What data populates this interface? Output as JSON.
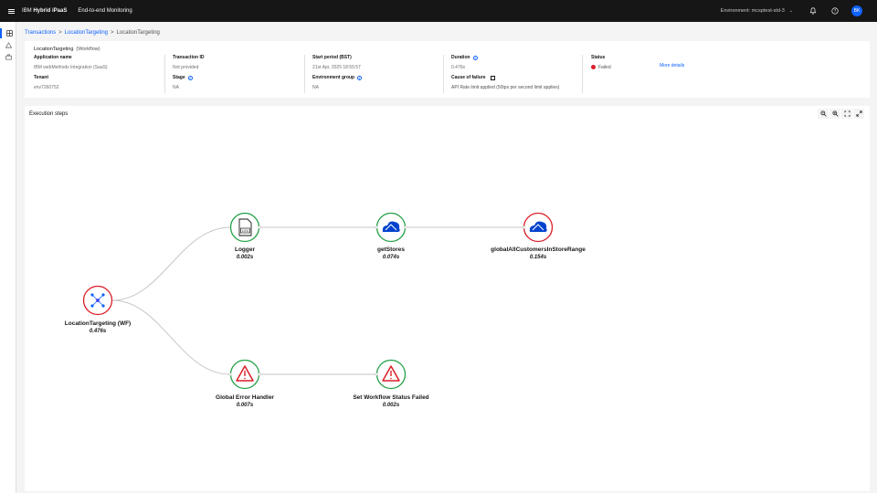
{
  "topbar": {
    "brand_prefix": "IBM ",
    "brand_name": "Hybrid iPaaS",
    "product": "End-to-end Monitoring",
    "environment": "Environment: mcsptest-std-3",
    "avatar_initials": "BK"
  },
  "breadcrumb": {
    "items": [
      "Transactions",
      "LocationTargeting",
      "LocationTargeting"
    ],
    "separator": ">"
  },
  "summary": {
    "name": "LocationTargeting",
    "kind": "(Workflow)",
    "application_name": {
      "label": "Application name",
      "value": "IBM webMethods Integration (SaaS)"
    },
    "tenant": {
      "label": "Tenant",
      "value": "env7260752"
    },
    "transaction_id": {
      "label": "Transaction ID",
      "value": "Not provided"
    },
    "stage": {
      "label": "Stage",
      "value": "NA"
    },
    "start_period": {
      "label": "Start period (BST)",
      "value": "21st Apr, 2025 18:55:57"
    },
    "environment_group": {
      "label": "Environment group",
      "value": "NA"
    },
    "duration": {
      "label": "Duration",
      "value": "0.476s"
    },
    "cause_of_failure": {
      "label": "Cause of failure",
      "value": "API Rate limit applied (50tps per second limit applies)"
    },
    "status": {
      "label": "Status",
      "value": "Failed"
    },
    "more_details": "More details"
  },
  "execution": {
    "title": "Execution steps",
    "nodes": [
      {
        "id": "root",
        "label": "LocationTargeting (WF)",
        "duration": "0.476s",
        "status": "failed",
        "icon": "workflow-icon"
      },
      {
        "id": "logger",
        "label": "Logger",
        "duration": "0.002s",
        "status": "success",
        "icon": "log-icon"
      },
      {
        "id": "getstores",
        "label": "getStores",
        "duration": "0.074s",
        "status": "success",
        "icon": "cloud-connector-icon"
      },
      {
        "id": "global",
        "label": "globalAllCustomersInStoreRange",
        "duration": "0.154s",
        "status": "failed",
        "icon": "cloud-connector-icon"
      },
      {
        "id": "geh",
        "label": "Global Error Handler",
        "duration": "0.007s",
        "status": "success",
        "icon": "warning-icon"
      },
      {
        "id": "swsf",
        "label": "Set Workflow Status Failed",
        "duration": "0.002s",
        "status": "success",
        "icon": "warning-icon"
      }
    ]
  },
  "colors": {
    "accent": "#0f62fe",
    "success_ring": "#24a148",
    "failed_ring": "#da1e28",
    "edge": "#c6c6c6"
  }
}
